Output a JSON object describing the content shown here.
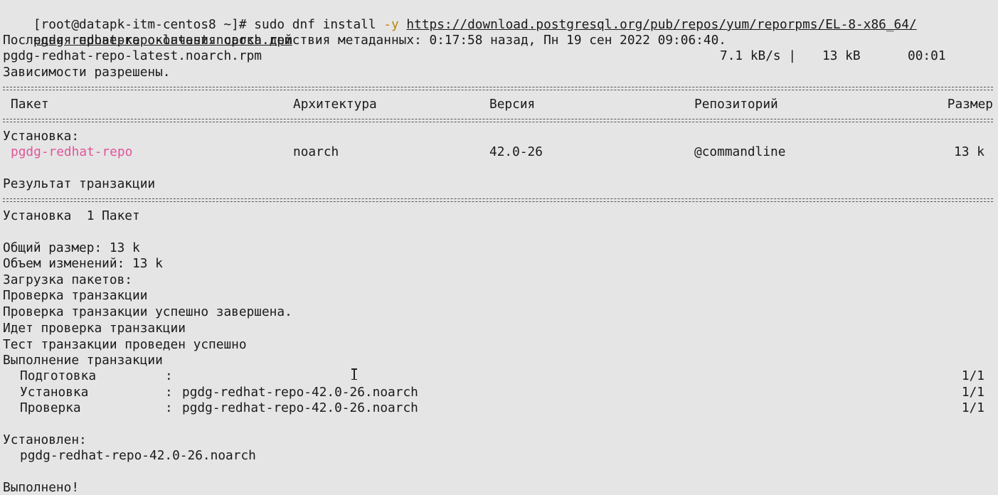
{
  "prompt": "[root@datapk-itm-centos8 ~]# ",
  "command": {
    "base": "sudo dnf install ",
    "flag": "-y",
    "url_part1": "https://download.postgresql.org/pub/repos/yum/reporpms/EL-8-x86_64/",
    "url_part2": "pgdg-redhat-repo-latest.noarch.rpm"
  },
  "metadata_check": "Последняя проверка окончания срока действия метаданных: 0:17:58 назад, Пн 19 сен 2022 09:06:40.",
  "download": {
    "file": "pgdg-redhat-repo-latest.noarch.rpm",
    "speed": "7.1 kB/s |",
    "size": "13 kB",
    "time": "00:01"
  },
  "deps_resolved": "Зависимости разрешены.",
  "table": {
    "headers": {
      "package": "Пакет",
      "arch": "Архитектура",
      "version": "Версия",
      "repo": "Репозиторий",
      "size": "Размер"
    },
    "section": "Установка:",
    "row": {
      "package": "pgdg-redhat-repo",
      "arch": "noarch",
      "version": "42.0-26",
      "repo": "@commandline",
      "size": "13 k"
    }
  },
  "summary": {
    "title": "Результат транзакции",
    "install_count": "Установка  1 Пакет",
    "total_size": "Общий размер: 13 k",
    "change_size": "Объем изменений: 13 k"
  },
  "log": [
    "Загрузка пакетов:",
    "Проверка транзакции",
    "Проверка транзакции успешно завершена.",
    "Идет проверка транзакции",
    "Тест транзакции проведен успешно",
    "Выполнение транзакции"
  ],
  "steps": [
    {
      "name": "Подготовка",
      "sep": ":",
      "target": "",
      "progress": "1/1"
    },
    {
      "name": "Установка",
      "sep": ":",
      "target": "pgdg-redhat-repo-42.0-26.noarch",
      "progress": "1/1"
    },
    {
      "name": "Проверка",
      "sep": ":",
      "target": "pgdg-redhat-repo-42.0-26.noarch",
      "progress": "1/1"
    }
  ],
  "installed_label": "Установлен:",
  "installed_pkg": "pgdg-redhat-repo-42.0-26.noarch",
  "done": "Выполнено!"
}
